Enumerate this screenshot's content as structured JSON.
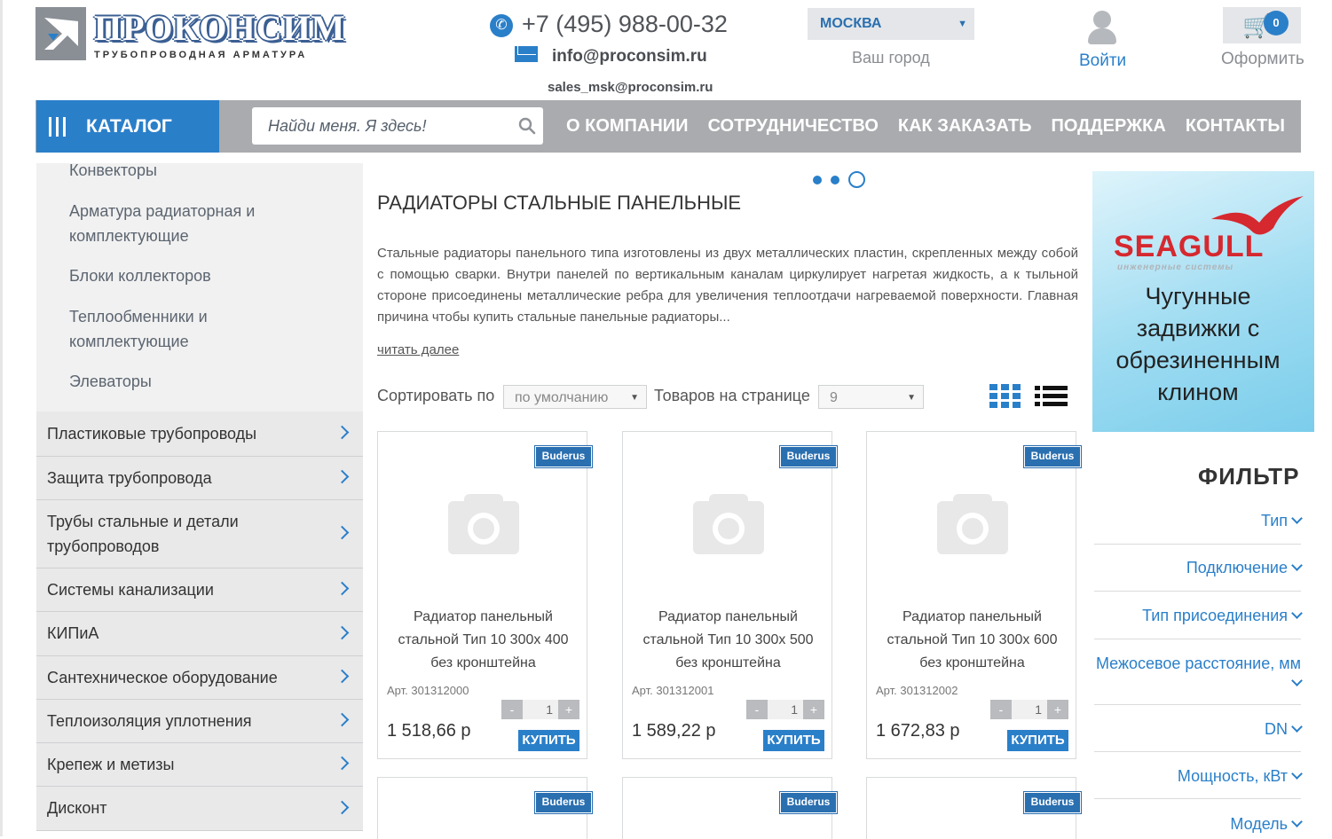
{
  "header": {
    "logo_name": "ПРОКОНСИМ",
    "logo_subtitle": "ТРУБОПРОВОДНАЯ АРМАТУРА",
    "phone": "+7 (495) 988-00-32",
    "email": "info@proconsim.ru",
    "email_sales": "sales_msk@proconsim.ru",
    "city": "МОСКВА",
    "city_caption": "Ваш город",
    "login": "Войти",
    "cart_count": "0",
    "checkout": "Оформить"
  },
  "nav": {
    "catalog": "КАТАЛОГ",
    "search_placeholder": "Найди меня. Я здесь!",
    "items": [
      "О КОМПАНИИ",
      "СОТРУДНИЧЕСТВО",
      "КАК ЗАКАЗАТЬ",
      "ПОДДЕРЖКА",
      "КОНТАКТЫ"
    ]
  },
  "sidebar": {
    "subitems": [
      "Конвекторы",
      "Арматура радиаторная и комплектующие",
      "Блоки коллекторов",
      "Теплообменники и комплектующие",
      "Элеваторы"
    ],
    "categories": [
      "Пластиковые трубопроводы",
      "Защита трубопровода",
      "Трубы стальные и детали трубопроводов",
      "Системы канализации",
      "КИПиА",
      "Сантехническое оборудование",
      "Теплоизоляция уплотнения",
      "Крепеж и метизы",
      "Дисконт"
    ]
  },
  "main": {
    "title": "РАДИАТОРЫ СТАЛЬНЫЕ ПАНЕЛЬНЫЕ",
    "description": "Стальные радиаторы панельного типа изготовлены из двух металлических пластин, скрепленных между собой с помощью сварки. Внутри панелей по вертикальным каналам циркулирует нагретая жидкость, а к тыльной стороне присоединены металлические ребра для увеличения теплоотдачи нагреваемой поверхности. Главная причина чтобы купить стальные панельные радиаторы...",
    "read_more": "читать далее",
    "sort_label": "Сортировать по",
    "sort_value": "по умолчанию",
    "per_page_label": "Товаров на странице",
    "per_page_value": "9"
  },
  "products": [
    {
      "brand": "Buderus",
      "name": "Радиатор панельный стальной Тип 10 300х 400 без кронштейна",
      "art": "Арт. 301312000",
      "qty": "1",
      "price": "1 518,66 р",
      "buy": "КУПИТЬ"
    },
    {
      "brand": "Buderus",
      "name": "Радиатор панельный стальной Тип 10 300х 500 без кронштейна",
      "art": "Арт. 301312001",
      "qty": "1",
      "price": "1 589,22 р",
      "buy": "КУПИТЬ"
    },
    {
      "brand": "Buderus",
      "name": "Радиатор панельный стальной Тип 10 300х 600 без кронштейна",
      "art": "Арт. 301312002",
      "qty": "1",
      "price": "1 672,83 р",
      "buy": "КУПИТЬ"
    }
  ],
  "products_row2_brand": "Buderus",
  "banner": {
    "brand": "SEAGULL",
    "brand_sub": "инженерные системы",
    "text": "Чугунные задвижки с обрезиненным клином"
  },
  "filter": {
    "title": "ФИЛЬТР",
    "items": [
      "Тип",
      "Подключение",
      "Тип присоединения",
      "Межосевое расстояние, мм",
      "DN",
      "Мощность, кВт",
      "Модель"
    ]
  },
  "colors": {
    "accent": "#2a7fc9",
    "nav_gray": "#a9abae",
    "brand_red": "#d6282f"
  }
}
